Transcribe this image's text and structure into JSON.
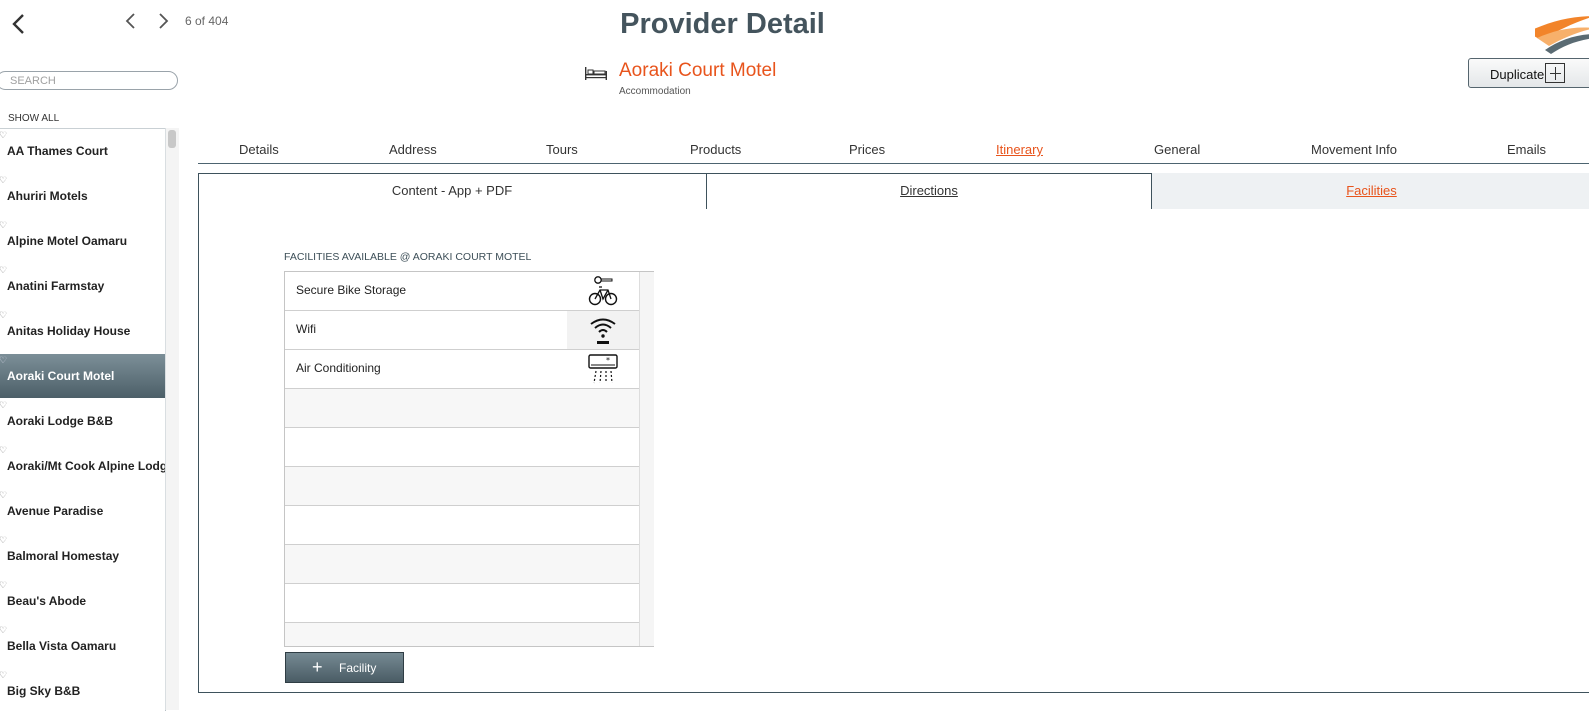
{
  "nav": {
    "counter": "6 of 404"
  },
  "header": {
    "title": "Provider Detail"
  },
  "search": {
    "placeholder": "SEARCH"
  },
  "show_all": "SHOW ALL",
  "providers": [
    "AA Thames Court",
    "Ahuriri Motels",
    "Alpine Motel Oamaru",
    "Anatini Farmstay",
    "Anitas Holiday House",
    "Aoraki Court Motel",
    "Aoraki Lodge B&B",
    "Aoraki/Mt Cook Alpine Lodge",
    "Avenue Paradise",
    "Balmoral Homestay",
    "Beau's Abode",
    "Bella Vista Oamaru",
    "Big Sky B&B"
  ],
  "selected_provider": "Aoraki Court Motel",
  "provider": {
    "name": "Aoraki Court Motel",
    "type": "Accommodation",
    "icon": "bed-icon"
  },
  "duplicate_label": "Duplicate",
  "tabs": [
    "Details",
    "Address",
    "Tours",
    "Products",
    "Prices",
    "Itinerary",
    "General",
    "Movement Info",
    "Emails"
  ],
  "active_tab": "Itinerary",
  "subtabs": [
    "Content - App + PDF",
    "Directions",
    "Facilities"
  ],
  "active_subtab": "Facilities",
  "facilities": {
    "heading": "FACILITIES AVAILABLE @ AORAKI COURT MOTEL",
    "items": [
      {
        "label": "Secure Bike Storage",
        "icon": "bike-lock-icon"
      },
      {
        "label": "Wifi",
        "icon": "wifi-icon"
      },
      {
        "label": "Air Conditioning",
        "icon": "air-conditioner-icon"
      }
    ],
    "add_label": "Facility"
  },
  "colors": {
    "accent": "#e8541c",
    "title": "#44545d",
    "selected": "#5b6e77"
  }
}
